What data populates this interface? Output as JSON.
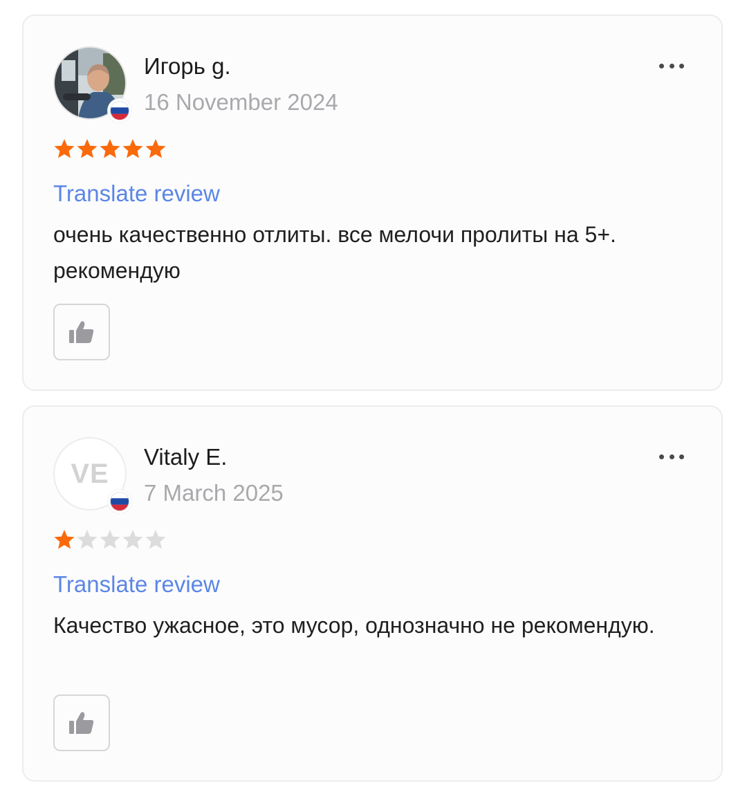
{
  "reviews": [
    {
      "author": "Игорь g.",
      "date": "16 November 2024",
      "avatar": "photo",
      "country_flag": "russia-flag-icon",
      "rating": 5,
      "rating_max": 5,
      "translate_label": "Translate review",
      "text": "очень качественно отлиты. все мелочи пролиты на 5+. рекомендую",
      "like_icon": "thumbs-up-icon",
      "more_icon": "more-options-icon"
    },
    {
      "author": "Vitaly E.",
      "date": "7 March 2025",
      "avatar_initials": "VE",
      "country_flag": "russia-flag-icon",
      "rating": 1,
      "rating_max": 5,
      "translate_label": "Translate review",
      "text": "Качество  ужасное, это мусор, однозначно не рекомендую.",
      "like_icon": "thumbs-up-icon",
      "more_icon": "more-options-icon"
    }
  ],
  "colors": {
    "star_filled": "#fa6a0a",
    "star_empty": "#dcdcdc",
    "link": "#5b86e5",
    "date": "#a9a9ad"
  }
}
